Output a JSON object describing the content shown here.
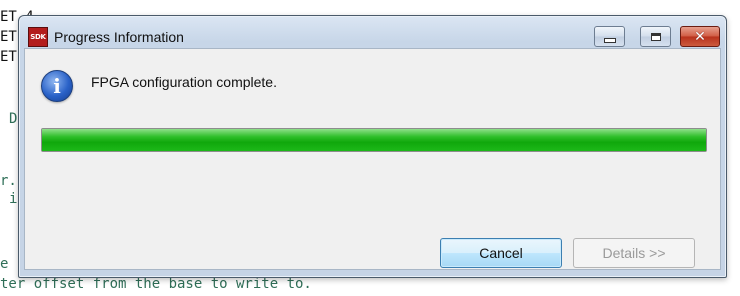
{
  "background_code": {
    "lines": [
      {
        "text": "ET 4",
        "color": "#111111"
      },
      {
        "text": "ET",
        "color": "#111111"
      },
      {
        "text": "ET",
        "color": "#111111"
      },
      {
        "text": "D",
        "color": "#2f6f58"
      },
      {
        "text": "r.",
        "color": "#2f6f58"
      },
      {
        "text": "i",
        "color": "#2f6f58"
      },
      {
        "text": "e",
        "color": "#2f6f58"
      },
      {
        "text": "ter offset from the base to write to.",
        "color": "#2f6f58"
      }
    ]
  },
  "dialog": {
    "title": "Progress Information",
    "app_icon_text": "SDK",
    "message": "FPGA configuration complete.",
    "progress_fraction": 1.0,
    "buttons": {
      "cancel": "Cancel",
      "details": "Details >>"
    },
    "caption_buttons": {
      "close": "✕"
    }
  },
  "colors": {
    "progress_green": "#10a80c",
    "close_red": "#c4452d",
    "info_blue": "#2a62c8"
  },
  "icons": {
    "info": "info-icon",
    "app": "sdk-app-icon",
    "minimize": "minimize-icon",
    "maximize": "maximize-icon",
    "close": "close-icon"
  }
}
